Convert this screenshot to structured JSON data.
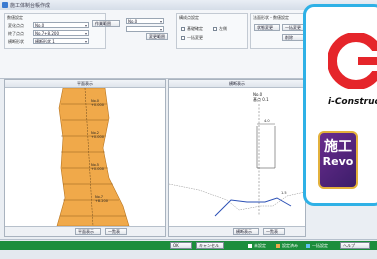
{
  "window": {
    "title": "施工体制台帳作成"
  },
  "toolbar": {
    "group1_label": "数値設定",
    "row1_label": "変化点点",
    "row1_value": "No.0",
    "row2_label": "終了点点",
    "row2_value": "No.7+8.200",
    "row3_label": "横断形状",
    "row3_value": "横断形状 1",
    "mid_combo1": "No.0",
    "mid_combo2": "",
    "mid_btn1": "作業範囲",
    "mid_btn2": "変更範囲",
    "mid_btn3": "",
    "group2_label": "構成点設定",
    "chk1": "基礎確定",
    "chk2": "左側",
    "chk3": "一括変更",
    "group3_label": "法面形状・数値設定",
    "btn_r1": "状態変更",
    "btn_r2": "一括変更",
    "btn_r3": "削除"
  },
  "panes": {
    "plan_title": "平面表示",
    "section_title": "横断表示"
  },
  "plan": {
    "stations": [
      {
        "name": "No.0",
        "sub": "+0.000"
      },
      {
        "name": "No.2",
        "sub": "+0.000"
      },
      {
        "name": "No.5",
        "sub": "+0.000"
      },
      {
        "name": "No.7",
        "sub": "+8.200"
      }
    ],
    "fill_color": "#f0a94a"
  },
  "section": {
    "label1": "No.0",
    "label2": "基点 0.1",
    "label3": "4.0",
    "label4": "1.5"
  },
  "footer": {
    "left_btn1": "平面表示",
    "left_btn2": "一覧表",
    "right_btn1": "横断表示",
    "right_btn2": "一覧表"
  },
  "statusbar": {
    "ok_label": "OK",
    "cancel_label": "キャンセル",
    "legend1": "未設定",
    "legend2": "設定済み",
    "legend3": "一括設定",
    "help_label": "ヘルプ"
  },
  "brand": {
    "name": "i-Construction",
    "badge_line1": "施工",
    "badge_line2": "Revo",
    "accent": "#2fb1e6",
    "logo_red": "#e5252a",
    "badge_purple": "#5a2886",
    "badge_gold": "#e3b13c"
  }
}
